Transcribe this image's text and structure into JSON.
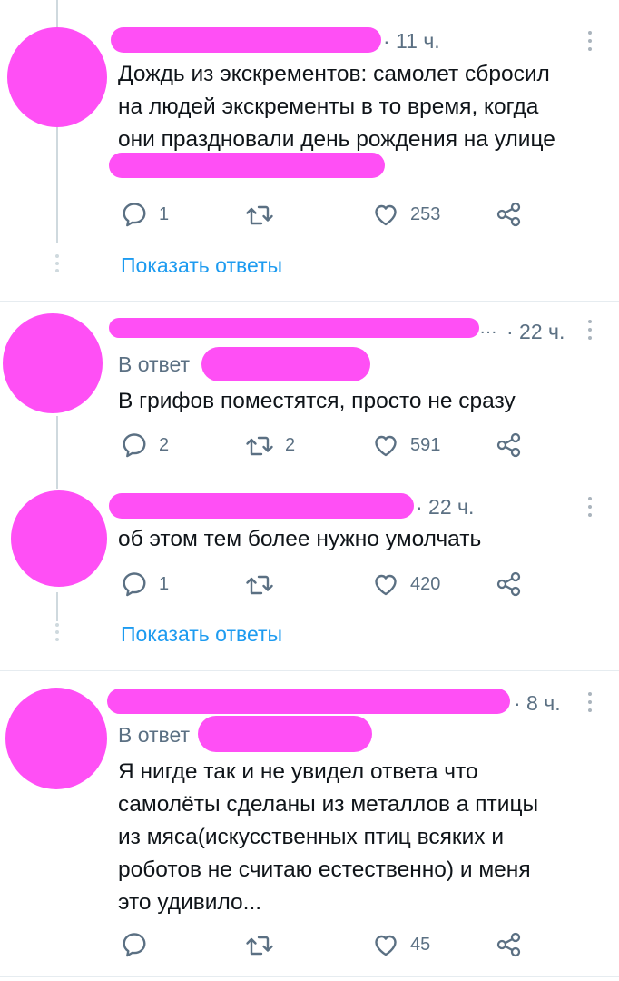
{
  "tweets": [
    {
      "time": "· 11 ч.",
      "text": "Дождь из экскрементов: самолет сбросил\nна людей экскременты в то время, когда\nони праздновали день рождения на улице",
      "replies": "1",
      "retweets": "",
      "likes": "253"
    },
    {
      "time": "· 22 ч.",
      "name_fragment": "…",
      "reply_prefix": "В ответ",
      "text": "В грифов поместятся, просто не сразу",
      "replies": "2",
      "retweets": "2",
      "likes": "591"
    },
    {
      "time": "· 22 ч.",
      "text": "об этом тем более нужно умолчать",
      "replies": "1",
      "retweets": "",
      "likes": "420"
    },
    {
      "time": "· 8 ч.",
      "reply_prefix": "В ответ",
      "text": "Я нигде так и не увидел ответа что\nсамолёты сделаны из металлов а птицы\nиз мяса(искусственных птиц всяких и\nроботов не считаю естественно) и меня\nэто удивило...",
      "replies": "",
      "retweets": "",
      "likes": "45"
    }
  ],
  "show_replies_label": "Показать ответы",
  "colors": {
    "redaction": "#ff4ff5",
    "link": "#1d9bf0",
    "muted": "#5b7083"
  }
}
